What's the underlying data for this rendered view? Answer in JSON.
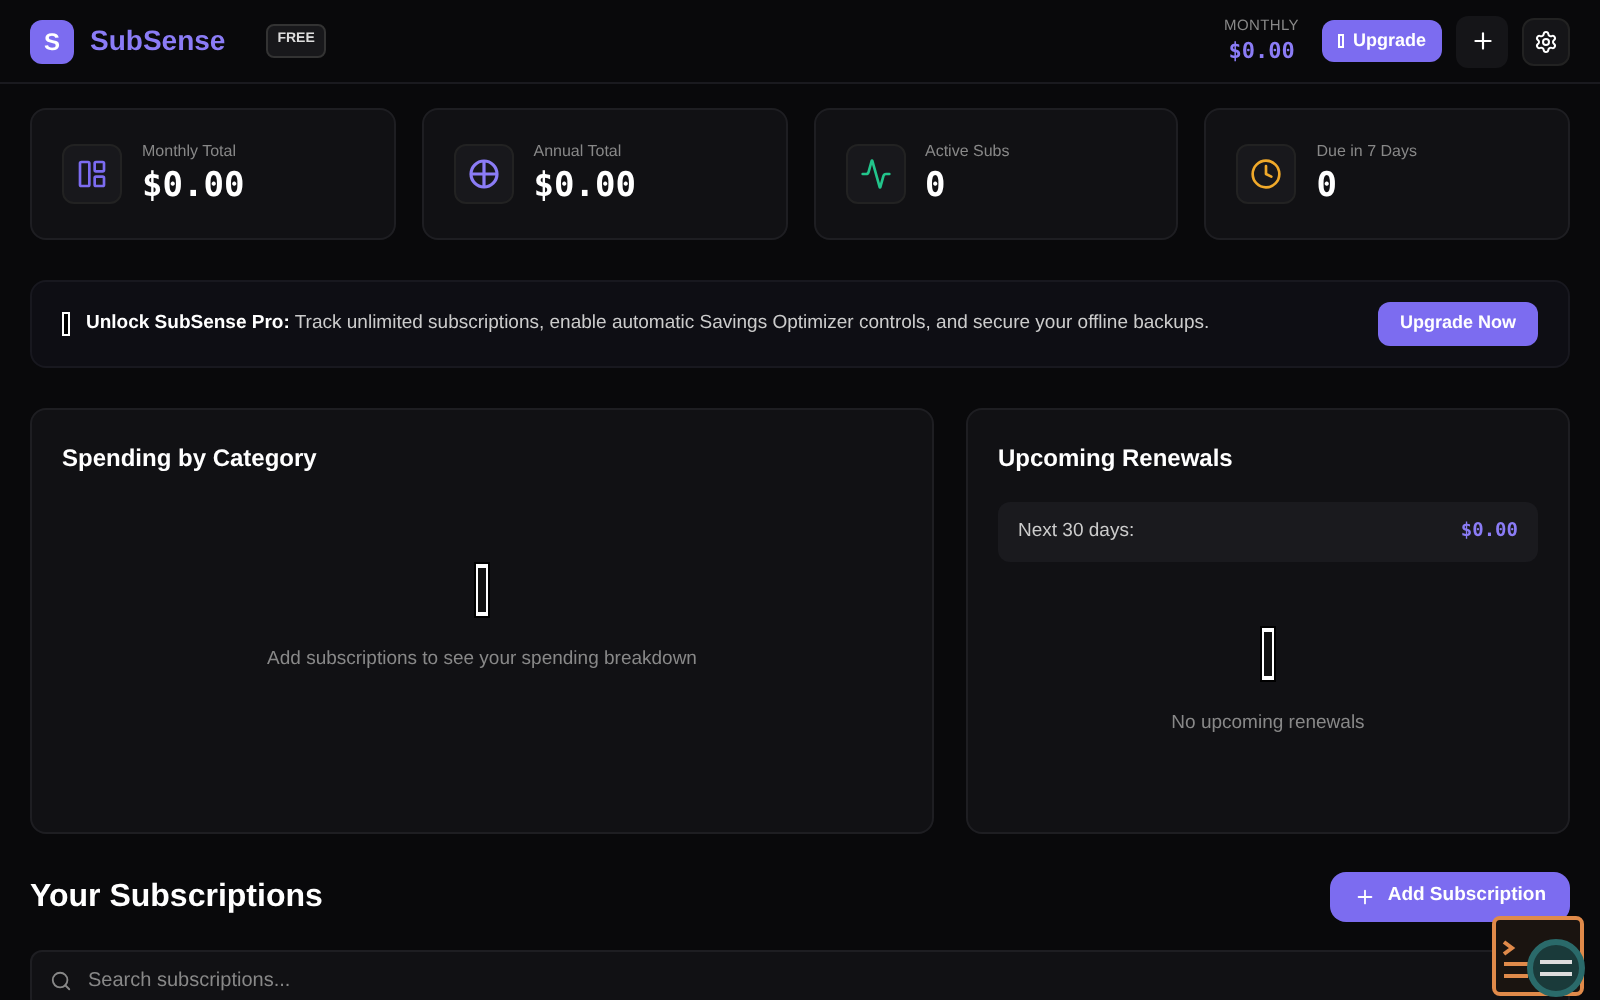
{
  "header": {
    "logo_letter": "S",
    "app_name": "SubSense",
    "plan_badge": "FREE",
    "monthly_label": "MONTHLY",
    "monthly_value": "$0.00",
    "upgrade_button": "Upgrade"
  },
  "stats": [
    {
      "kind": "monthly",
      "label": "Monthly Total",
      "value": "$0.00"
    },
    {
      "kind": "annual",
      "label": "Annual Total",
      "value": "$0.00"
    },
    {
      "kind": "active",
      "label": "Active Subs",
      "value": "0"
    },
    {
      "kind": "due",
      "label": "Due in 7 Days",
      "value": "0"
    }
  ],
  "banner": {
    "title": "Unlock SubSense Pro:",
    "text": "Track unlimited subscriptions, enable automatic Savings Optimizer controls, and secure your offline backups.",
    "button": "Upgrade Now"
  },
  "spending": {
    "title": "Spending by Category",
    "empty_text": "Add subscriptions to see your spending breakdown"
  },
  "renewals": {
    "title": "Upcoming Renewals",
    "period_label": "Next 30 days:",
    "period_value": "$0.00",
    "empty_text": "No upcoming renewals"
  },
  "subscriptions": {
    "title": "Your Subscriptions",
    "add_button": "Add Subscription",
    "search": {
      "placeholder": "Search subscriptions..."
    }
  }
}
